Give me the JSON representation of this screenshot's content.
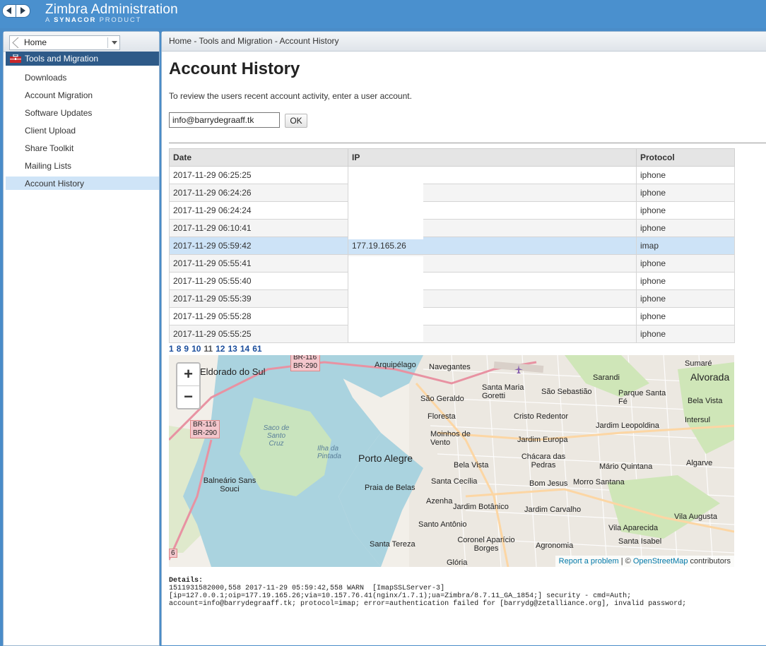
{
  "app": {
    "brand": "Zimbra Administration",
    "brand_sub_prefix": "A ",
    "brand_sub_company": "SYNACOR",
    "brand_sub_suffix": " PRODUCT",
    "nav_back_icon": "arrow-left-icon",
    "nav_forward_icon": "arrow-right-icon"
  },
  "sidebar": {
    "home_label": "Home",
    "section": "Tools and Migration",
    "items": [
      {
        "label": "Downloads"
      },
      {
        "label": "Account Migration"
      },
      {
        "label": "Software Updates"
      },
      {
        "label": "Client Upload"
      },
      {
        "label": "Share Toolkit"
      },
      {
        "label": "Mailing Lists"
      },
      {
        "label": "Account History",
        "active": true
      }
    ]
  },
  "main": {
    "breadcrumb": "Home - Tools and Migration - Account History",
    "title": "Account History",
    "intro": "To review the users recent account activity, enter a user account.",
    "account_value": "info@barrydegraaff.tk",
    "ok_label": "OK",
    "table": {
      "headers": [
        "Date",
        "IP",
        "Protocol"
      ],
      "rows": [
        {
          "date": "2017-11-29 06:25:25",
          "ip": "",
          "protocol": "iphone"
        },
        {
          "date": "2017-11-29 06:24:26",
          "ip": "",
          "protocol": "iphone"
        },
        {
          "date": "2017-11-29 06:24:24",
          "ip": "",
          "protocol": "iphone"
        },
        {
          "date": "2017-11-29 06:10:41",
          "ip": "",
          "protocol": "iphone"
        },
        {
          "date": "2017-11-29 05:59:42",
          "ip": "177.19.165.26",
          "protocol": "imap",
          "selected": true
        },
        {
          "date": "2017-11-29 05:55:41",
          "ip": "",
          "protocol": "iphone"
        },
        {
          "date": "2017-11-29 05:55:40",
          "ip": "",
          "protocol": "iphone"
        },
        {
          "date": "2017-11-29 05:55:39",
          "ip": "",
          "protocol": "iphone"
        },
        {
          "date": "2017-11-29 05:55:28",
          "ip": "",
          "protocol": "iphone"
        },
        {
          "date": "2017-11-29 05:55:25",
          "ip": "",
          "protocol": "iphone"
        }
      ]
    },
    "pager": [
      "1",
      "8",
      "9",
      "10",
      "11",
      "12",
      "13",
      "14",
      "61"
    ],
    "pager_current": "11",
    "map": {
      "zoom_in": "+",
      "zoom_out": "−",
      "labels": [
        "Eldorado do Sul",
        "BR-116",
        "BR-290",
        "BR-116",
        "BR-290",
        "Arquipélago",
        "Navegantes",
        "Sarandi",
        "Sumaré",
        "Alvorada",
        "Santa Maria Goretti",
        "São Sebastião",
        "Parque Santa Fé",
        "Bela Vista",
        "São Geraldo",
        "Intersul",
        "Floresta",
        "Cristo Redentor",
        "Jardim Leopoldina",
        "Saco de Santo Cruz",
        "Moinhos de Vento",
        "Jardim Europa",
        "Ilha da Pintada",
        "Porto Alegre",
        "Bela Vista",
        "Chácara das Pedras",
        "Mário Quintana",
        "Algarve",
        "Balneário Sans Souci",
        "Praia de Belas",
        "Santa Cecília",
        "Bom Jesus",
        "Morro Santana",
        "Azenha",
        "Jardim Botânico",
        "Jardim Carvalho",
        "Vila Augusta",
        "Santo Antônio",
        "Vila Aparecida",
        "Coronel Aparício Borges",
        "Agronomia",
        "Santa Isabel",
        "Santa Tereza",
        "Glória",
        "6"
      ],
      "report_link": "Report a problem",
      "attrib_sep": " | © ",
      "osm_link": "OpenStreetMap",
      "attrib_suffix": " contributors"
    },
    "details_label": "Details:",
    "details_text": "1511931582000,558 2017-11-29 05:59:42,558 WARN  [ImapSSLServer-3]\n[ip=127.0.0.1;oip=177.19.165.26;via=10.157.76.41(nginx/1.7.1);ua=Zimbra/8.7.11_GA_1854;] security - cmd=Auth;\naccount=info@barrydegraaff.tk; protocol=imap; error=authentication failed for [barrydg@zetalliance.org], invalid password;"
  }
}
